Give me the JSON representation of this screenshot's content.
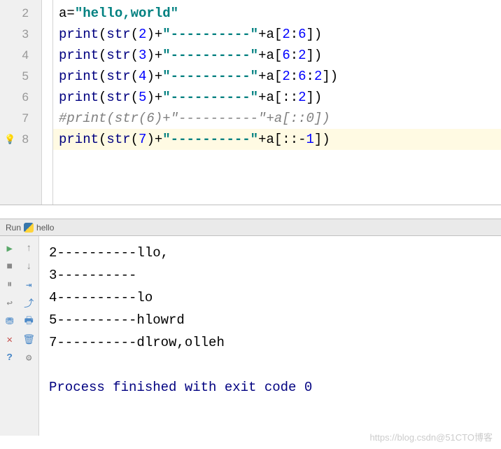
{
  "editor": {
    "lines": [
      {
        "num": "2",
        "tokens": [
          {
            "t": "a",
            "c": "kw-var"
          },
          {
            "t": "=",
            "c": "op"
          },
          {
            "t": "\"hello,world\"",
            "c": "str"
          }
        ]
      },
      {
        "num": "3",
        "tokens": [
          {
            "t": "print",
            "c": "func"
          },
          {
            "t": "(",
            "c": "bracket"
          },
          {
            "t": "str",
            "c": "builtin"
          },
          {
            "t": "(",
            "c": "bracket"
          },
          {
            "t": "2",
            "c": "num"
          },
          {
            "t": ")",
            "c": "bracket"
          },
          {
            "t": "+",
            "c": "op"
          },
          {
            "t": "\"----------\"",
            "c": "str"
          },
          {
            "t": "+a[",
            "c": "op"
          },
          {
            "t": "2",
            "c": "num"
          },
          {
            "t": ":",
            "c": "op"
          },
          {
            "t": "6",
            "c": "num"
          },
          {
            "t": "])",
            "c": "op"
          }
        ]
      },
      {
        "num": "4",
        "tokens": [
          {
            "t": "print",
            "c": "func"
          },
          {
            "t": "(",
            "c": "bracket"
          },
          {
            "t": "str",
            "c": "builtin"
          },
          {
            "t": "(",
            "c": "bracket"
          },
          {
            "t": "3",
            "c": "num"
          },
          {
            "t": ")",
            "c": "bracket"
          },
          {
            "t": "+",
            "c": "op"
          },
          {
            "t": "\"----------\"",
            "c": "str"
          },
          {
            "t": "+a[",
            "c": "op"
          },
          {
            "t": "6",
            "c": "num"
          },
          {
            "t": ":",
            "c": "op"
          },
          {
            "t": "2",
            "c": "num"
          },
          {
            "t": "])",
            "c": "op"
          }
        ]
      },
      {
        "num": "5",
        "tokens": [
          {
            "t": "print",
            "c": "func"
          },
          {
            "t": "(",
            "c": "bracket"
          },
          {
            "t": "str",
            "c": "builtin"
          },
          {
            "t": "(",
            "c": "bracket"
          },
          {
            "t": "4",
            "c": "num"
          },
          {
            "t": ")",
            "c": "bracket"
          },
          {
            "t": "+",
            "c": "op"
          },
          {
            "t": "\"----------\"",
            "c": "str"
          },
          {
            "t": "+a[",
            "c": "op"
          },
          {
            "t": "2",
            "c": "num"
          },
          {
            "t": ":",
            "c": "op"
          },
          {
            "t": "6",
            "c": "num"
          },
          {
            "t": ":",
            "c": "op"
          },
          {
            "t": "2",
            "c": "num"
          },
          {
            "t": "])",
            "c": "op"
          }
        ]
      },
      {
        "num": "6",
        "tokens": [
          {
            "t": "print",
            "c": "func"
          },
          {
            "t": "(",
            "c": "bracket"
          },
          {
            "t": "str",
            "c": "builtin"
          },
          {
            "t": "(",
            "c": "bracket"
          },
          {
            "t": "5",
            "c": "num"
          },
          {
            "t": ")",
            "c": "bracket"
          },
          {
            "t": "+",
            "c": "op"
          },
          {
            "t": "\"----------\"",
            "c": "str"
          },
          {
            "t": "+a[::",
            "c": "op"
          },
          {
            "t": "2",
            "c": "num"
          },
          {
            "t": "])",
            "c": "op"
          }
        ]
      },
      {
        "num": "7",
        "tokens": [
          {
            "t": "#print(str(6)+\"----------\"+a[::0])",
            "c": "comment"
          }
        ]
      },
      {
        "num": "8",
        "hl": true,
        "bulb": true,
        "tokens": [
          {
            "t": "print",
            "c": "func"
          },
          {
            "t": "(",
            "c": "bracket"
          },
          {
            "t": "str",
            "c": "builtin"
          },
          {
            "t": "(",
            "c": "bracket"
          },
          {
            "t": "7",
            "c": "num"
          },
          {
            "t": ")",
            "c": "bracket"
          },
          {
            "t": "+",
            "c": "op"
          },
          {
            "t": "\"----------\"",
            "c": "str"
          },
          {
            "t": "+a[::-",
            "c": "op"
          },
          {
            "t": "1",
            "c": "num"
          },
          {
            "t": "])",
            "c": "op"
          }
        ]
      }
    ]
  },
  "run_tab": {
    "label": "Run",
    "script": "hello"
  },
  "toolbar_icons": {
    "play": "▶",
    "down": "↓",
    "up": "↑",
    "stop": "■",
    "pause": "⏸",
    "step": "⇥",
    "wrap": "↩",
    "export": "⤴",
    "filter": "⛃",
    "print": "🖶",
    "trash": "🗑",
    "close": "✕",
    "gear": "⚙",
    "help": "?"
  },
  "console": {
    "lines": [
      "2----------llo,",
      "3----------",
      "4----------lo",
      "5----------hlowrd",
      "7----------dlrow,olleh",
      "",
      "Process finished with exit code 0"
    ]
  },
  "watermark": "https://blog.csdn@51CTO博客"
}
